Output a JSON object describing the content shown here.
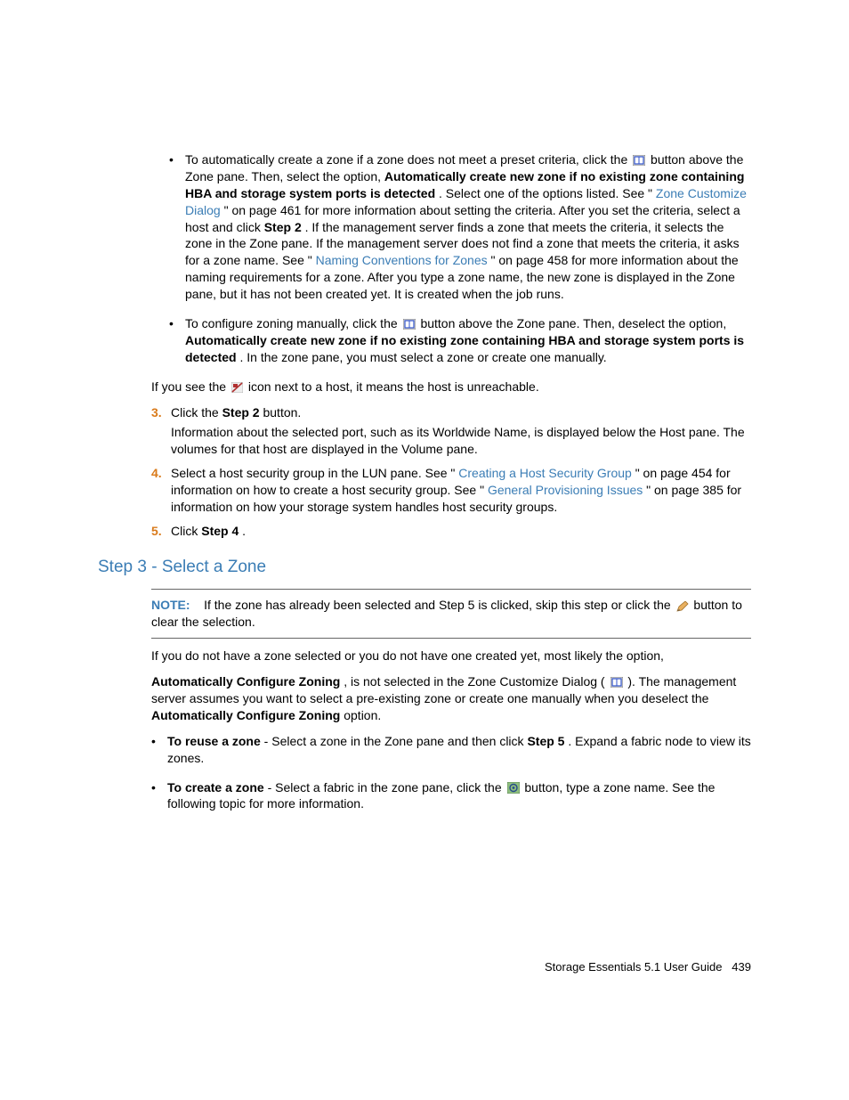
{
  "bullets_top": [
    {
      "pre": "To automatically create a zone if a zone does not meet a preset criteria, click the ",
      "post_icon": " button above the Zone pane. Then, select the option, ",
      "bold1": "Automatically create new zone if no existing zone containing HBA and storage system ports is detected",
      "after_bold1": ". Select one of the options listed. See \"",
      "link1": "Zone Customize Dialog",
      "after_link1": "\" on page 461 for more information about setting the criteria. After you set the criteria, select a host and click ",
      "bold2": "Step 2",
      "after_bold2": ". If the management server finds a zone that meets the criteria, it selects the zone in the Zone pane. If the management server does not find a zone that meets the criteria, it asks for a zone name. See \"",
      "link2": "Naming Conventions for Zones",
      "after_link2": "\" on page 458 for more information about the naming requirements for a zone. After you type a zone name, the new zone is displayed in the Zone pane, but it has not been created yet. It is created when the job runs."
    },
    {
      "pre": "To configure zoning manually, click the ",
      "post_icon": " button above the Zone pane. Then, deselect the option, ",
      "bold1": "Automatically create new zone if no existing zone containing HBA and storage system ports is detected",
      "after_bold1": ". In the zone pane, you must select a zone or create one manually."
    }
  ],
  "unreachable": {
    "pre": "If you see the ",
    "post": " icon next to a host, it means the host is unreachable."
  },
  "steps": {
    "s3": {
      "marker": "3.",
      "line1a": "Click the ",
      "line1bold": "Step 2",
      "line1b": " button.",
      "line2": "Information about the selected port, such as its Worldwide Name, is displayed below the Host pane. The volumes for that host are displayed in the Volume pane."
    },
    "s4": {
      "marker": "4.",
      "pre": "Select a host security group in the LUN pane. See \"",
      "link1": "Creating a Host Security Group",
      "mid": "\" on page 454 for information on how to create a host security group. See \"",
      "link2": "General Provisioning Issues",
      "post": "\" on page 385 for information on how your storage system handles host security groups."
    },
    "s5": {
      "marker": "5.",
      "pre": "Click ",
      "bold": "Step 4",
      "post": "."
    }
  },
  "section_heading": "Step 3 - Select a Zone",
  "note": {
    "label": "NOTE:",
    "pre": "If the zone has already been selected and Step 5 is clicked, skip this step or click the ",
    "post": " button to clear the selection."
  },
  "para1": "If you do not have a zone selected or you do not have one created yet, most likely the option,",
  "para2": {
    "bold1": "Automatically Configure Zoning",
    "mid1": ", is not selected in the Zone Customize Dialog (",
    "mid2": "). The management server assumes you want to select a pre-existing zone or create one manually when you deselect the ",
    "bold2": "Automatically Configure Zoning",
    "post": " option."
  },
  "bullets_bottom": [
    {
      "bold": "To reuse a zone",
      "bullet_dash": " -  ",
      "pre": "Select a zone in the Zone pane and then click ",
      "bold2": "Step 5",
      "post": ". Expand a fabric node to view its zones."
    },
    {
      "bold": "To create a zone",
      "bullet_dash": " - ",
      "pre": "Select a fabric in the zone pane, click the ",
      "post": " button, type a zone name. See the following topic for more information."
    }
  ],
  "footer": {
    "text": "Storage Essentials 5.1 User Guide",
    "page": "439"
  }
}
